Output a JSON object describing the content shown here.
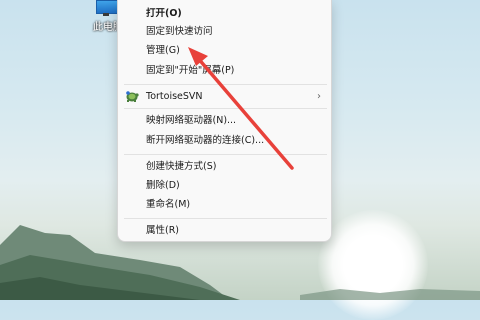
{
  "desktop_icon": {
    "label": "此电脑"
  },
  "menu": {
    "items": [
      {
        "label": "打开(O)",
        "bold": true
      },
      {
        "label": "固定到快速访问"
      },
      {
        "label": "管理(G)"
      },
      {
        "label": "固定到\"开始\"屏幕(P)"
      },
      {
        "label": "TortoiseSVN",
        "icon": "tortoisesvn-icon",
        "submenu": true
      },
      {
        "label": "映射网络驱动器(N)..."
      },
      {
        "label": "断开网络驱动器的连接(C)..."
      },
      {
        "label": "创建快捷方式(S)"
      },
      {
        "label": "删除(D)"
      },
      {
        "label": "重命名(M)"
      },
      {
        "label": "属性(R)"
      }
    ],
    "submenu_glyph": "›"
  },
  "annotation": {
    "color": "#e8413a"
  }
}
